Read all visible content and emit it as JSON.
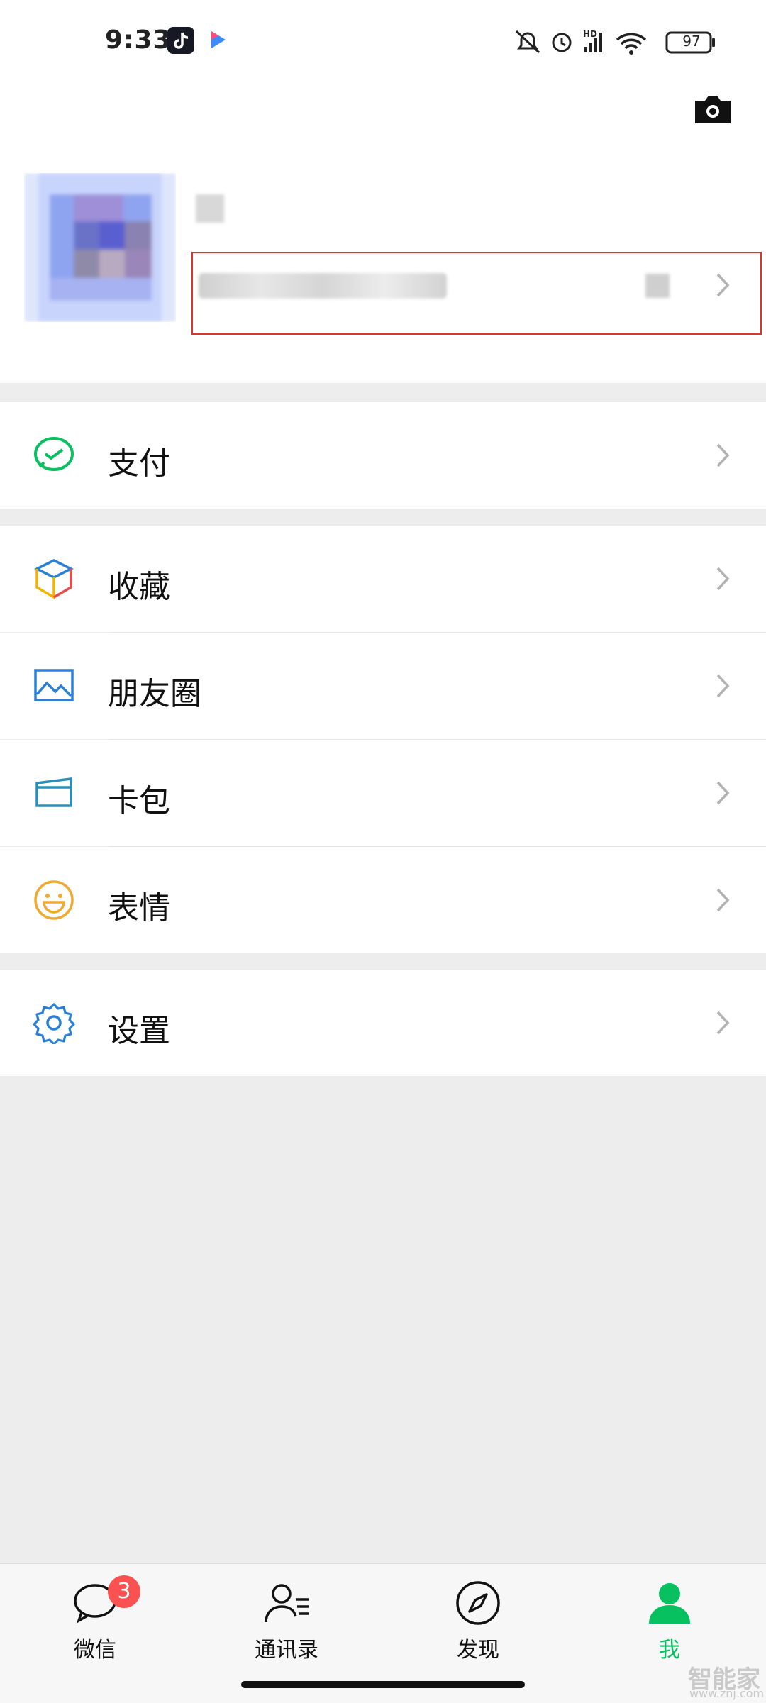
{
  "status_bar": {
    "time": "9:33",
    "battery": "97",
    "network": "HD"
  },
  "header": {
    "wechat_id_masked": ""
  },
  "menu": {
    "pay": "支付",
    "favorites": "收藏",
    "moments": "朋友圈",
    "cards": "卡包",
    "stickers": "表情",
    "settings": "设置"
  },
  "tabbar": {
    "chats": "微信",
    "chats_badge": "3",
    "contacts": "通讯录",
    "discover": "发现",
    "me": "我"
  },
  "watermark": {
    "text": "智能家",
    "url": "www.znj.com"
  },
  "colors": {
    "accent": "#07c160",
    "badge": "#fa5151",
    "highlight": "#e0312b",
    "background": "#ededed"
  }
}
